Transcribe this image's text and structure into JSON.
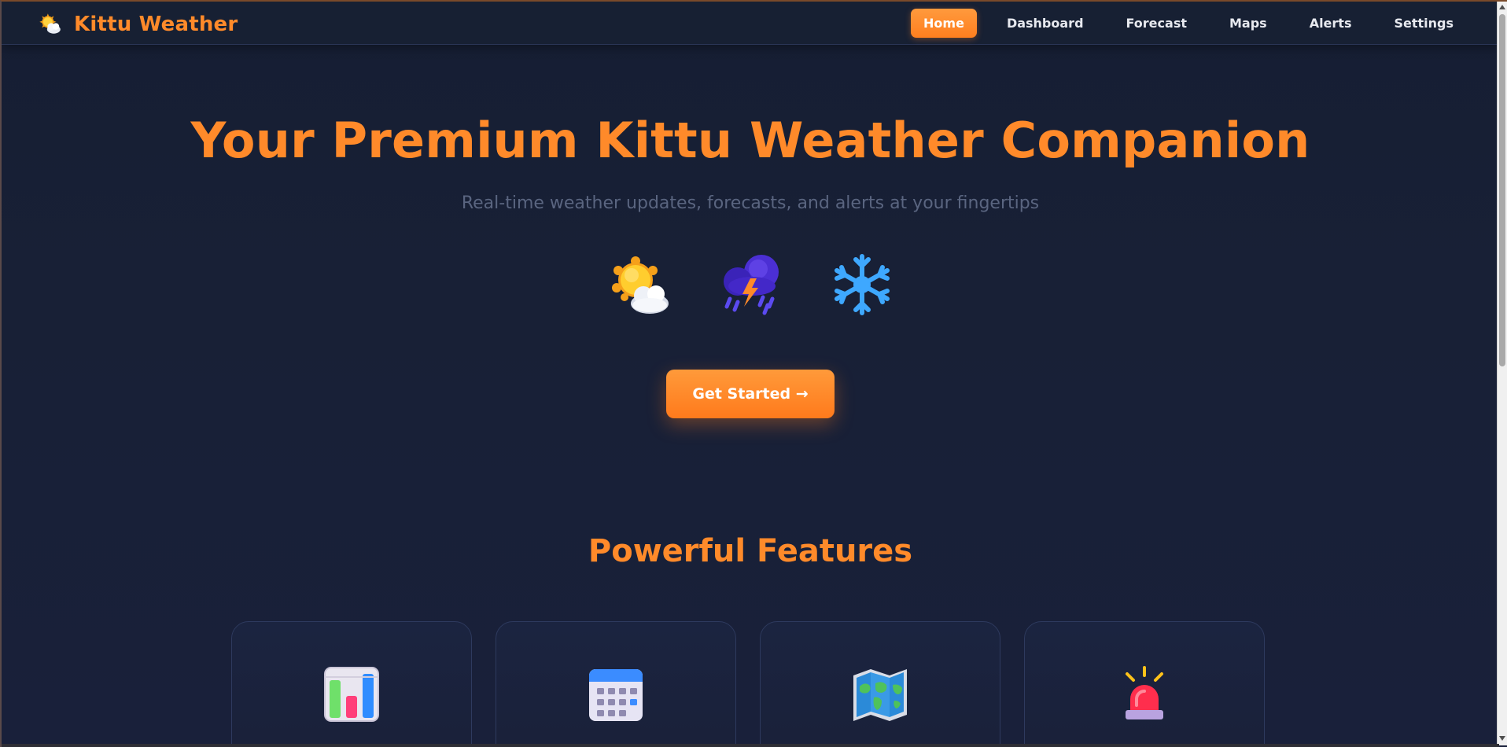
{
  "app": {
    "brand_name": "Kittu Weather",
    "brand_icon": "sun-behind-cloud-icon"
  },
  "nav": {
    "items": [
      {
        "label": "Home",
        "active": true
      },
      {
        "label": "Dashboard",
        "active": false
      },
      {
        "label": "Forecast",
        "active": false
      },
      {
        "label": "Maps",
        "active": false
      },
      {
        "label": "Alerts",
        "active": false
      },
      {
        "label": "Settings",
        "active": false
      }
    ]
  },
  "hero": {
    "title": "Your Premium Kittu Weather Companion",
    "subtitle": "Real-time weather updates, forecasts, and alerts at your fingertips",
    "icons": [
      "sun-behind-cloud-icon",
      "thunder-rain-cloud-icon",
      "snowflake-icon"
    ],
    "cta_label": "Get Started →"
  },
  "features": {
    "title": "Powerful Features",
    "cards": [
      {
        "icon": "bar-chart-icon"
      },
      {
        "icon": "calendar-icon"
      },
      {
        "icon": "world-map-icon"
      },
      {
        "icon": "alarm-light-icon"
      }
    ]
  },
  "colors": {
    "accent": "#ff8a2a",
    "background": "#172033",
    "card_border": "#2e3a5e",
    "subtitle": "#5a6580"
  }
}
